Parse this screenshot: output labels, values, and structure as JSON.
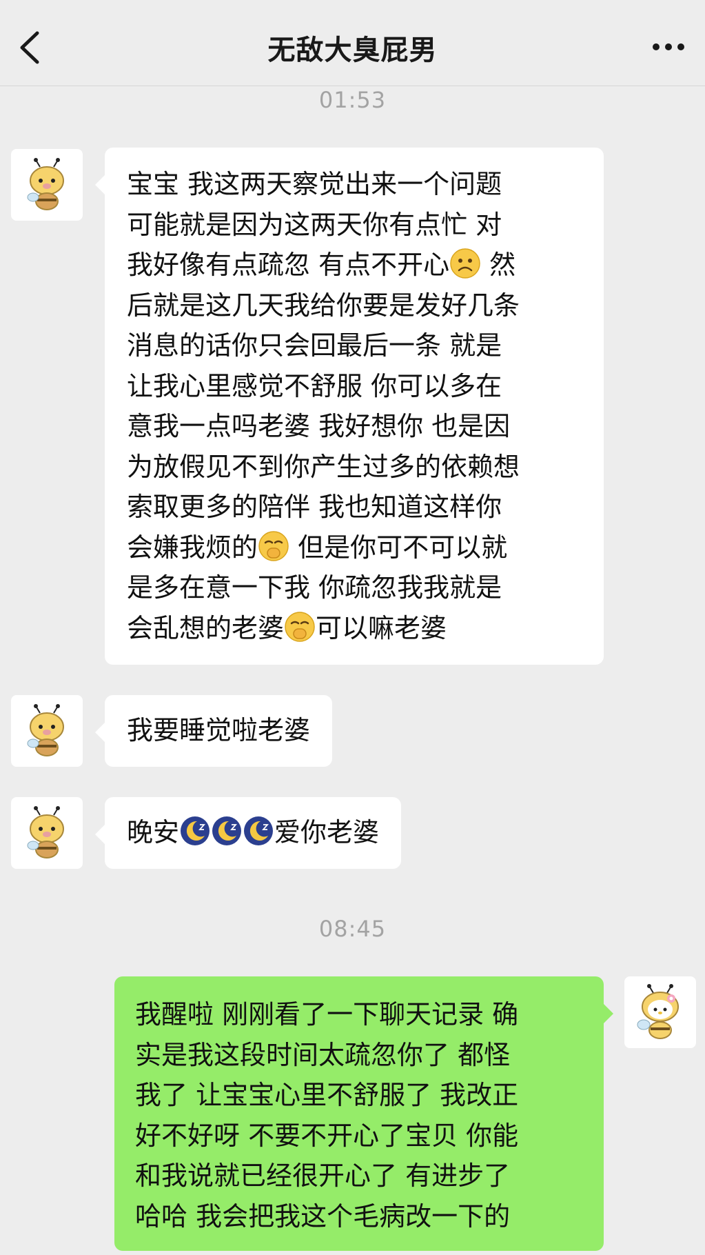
{
  "header": {
    "title": "无敌大臭屁男",
    "back_icon": "chevron-left-icon",
    "more_icon": "more-dots-icon"
  },
  "timestamps": [
    "01:53",
    "08:45"
  ],
  "messages": [
    {
      "side": "left",
      "lines": [
        "宝宝 我这两天察觉出来一个问题",
        "可能就是因为这两天你有点忙 对",
        "我好像有点疏忽 有点不开心",
        " 然",
        "后就是这几天我给你要是发好几条",
        "消息的话你只会回最后一条 就是",
        "让我心里感觉不舒服 你可以多在",
        "意我一点吗老婆 我好想你 也是因",
        "为放假见不到你产生过多的依赖想",
        "索取更多的陪伴 我也知道这样你",
        "会嫌我烦的",
        " 但是你可不可以就",
        "是多在意一下我 你疏忽我我就是",
        "会乱想的老婆",
        "可以嘛老婆"
      ]
    },
    {
      "side": "left",
      "text": "我要睡觉啦老婆"
    },
    {
      "side": "left",
      "pre": "晚安",
      "post": "爱你老婆",
      "emojis": [
        "moon-sleep-icon",
        "moon-sleep-icon",
        "moon-sleep-icon"
      ]
    },
    {
      "side": "right",
      "lines": [
        "我醒啦 刚刚看了一下聊天记录 确",
        "实是我这段时间太疏忽你了 都怪",
        "我了 让宝宝心里不舒服了 我改正",
        "好不好呀 不要不开心了宝贝  你能",
        "和我说就已经很开心了 有进步了",
        "哈哈 我会把我这个毛病改一下的"
      ]
    }
  ],
  "colors": {
    "background": "#ededed",
    "bubble_left": "#ffffff",
    "bubble_right": "#95ec69",
    "timestamp": "#a3a3a3"
  }
}
